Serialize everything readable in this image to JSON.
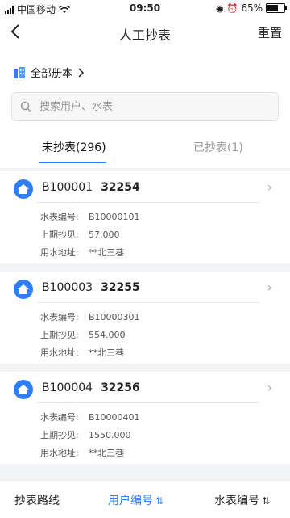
{
  "status_bar": {
    "carrier": "中国移动",
    "time": "09:50",
    "battery": "65%",
    "battery_level": 0.65
  },
  "nav": {
    "title": "人工抄表",
    "reset_label": "重置"
  },
  "book_selector": {
    "label": "全部册本",
    "icon": "building-icon"
  },
  "search": {
    "placeholder": "搜索用户、水表"
  },
  "tabs": [
    {
      "label": "未抄表(296)",
      "active": true
    },
    {
      "label": "已抄表(1)",
      "active": false
    }
  ],
  "records": [
    {
      "user_code": "B100001",
      "account": "32254",
      "meter_label": "水表编号:",
      "meter_no": "B10000101",
      "last_label": "上期抄见:",
      "last_reading": "57.000",
      "addr_label": "用水地址:",
      "address": "**北三巷"
    },
    {
      "user_code": "B100003",
      "account": "32255",
      "meter_label": "水表编号:",
      "meter_no": "B10000301",
      "last_label": "上期抄见:",
      "last_reading": "554.000",
      "addr_label": "用水地址:",
      "address": "**北三巷"
    },
    {
      "user_code": "B100004",
      "account": "32256",
      "meter_label": "水表编号:",
      "meter_no": "B10000401",
      "last_label": "上期抄见:",
      "last_reading": "1550.000",
      "addr_label": "用水地址:",
      "address": "**北三巷"
    }
  ],
  "bottom_bar": {
    "route_label": "抄表路线",
    "user_code_label": "用户编号",
    "meter_code_label": "水表编号"
  },
  "colors": {
    "accent": "#2f7ef7",
    "background": "#f2f3f5"
  }
}
